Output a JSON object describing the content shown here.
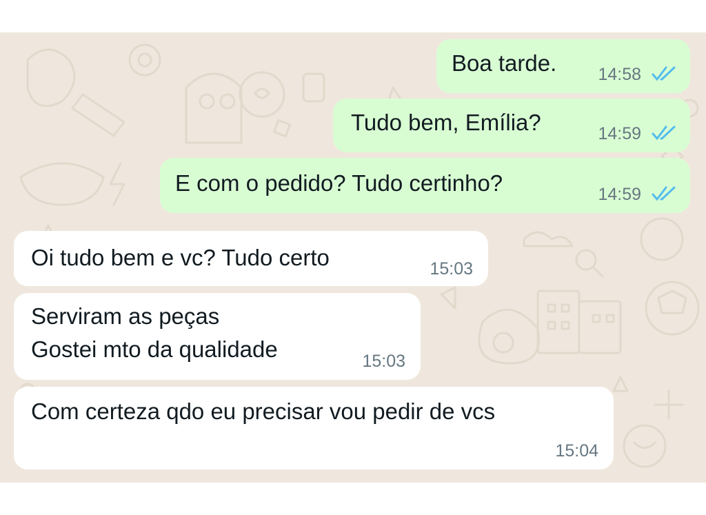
{
  "colors": {
    "outgoing_bubble": "#d9fdd3",
    "incoming_bubble": "#ffffff",
    "chat_background": "#efe7dd",
    "timestamp": "#667781",
    "read_ticks": "#53bdeb"
  },
  "messages": [
    {
      "direction": "outgoing",
      "text": "Boa tarde.",
      "time": "14:58",
      "status": "read-double-check-icon"
    },
    {
      "direction": "outgoing",
      "text": "Tudo bem, Emília?",
      "time": "14:59",
      "status": "read-double-check-icon"
    },
    {
      "direction": "outgoing",
      "text": "E com o pedido? Tudo certinho?",
      "time": "14:59",
      "status": "read-double-check-icon"
    },
    {
      "direction": "incoming",
      "text": "Oi tudo bem e vc? Tudo certo",
      "time": "15:03"
    },
    {
      "direction": "incoming",
      "lines": [
        "Serviram as peças",
        "Gostei mto da qualidade"
      ],
      "time": "15:03"
    },
    {
      "direction": "incoming",
      "text": "Com certeza qdo eu precisar vou pedir de vcs",
      "time": "15:04"
    }
  ]
}
